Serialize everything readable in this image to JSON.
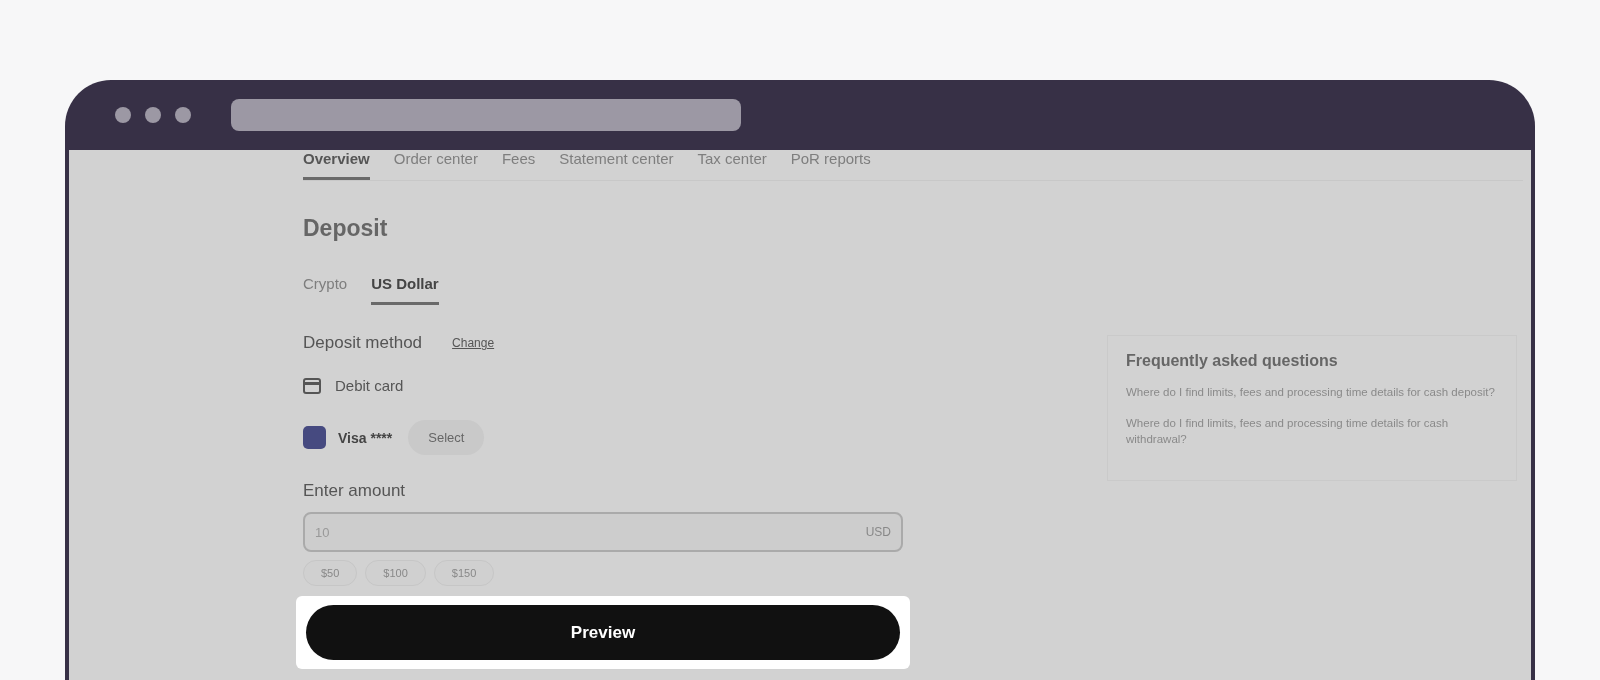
{
  "nav_tabs": [
    {
      "label": "Overview",
      "selected": true
    },
    {
      "label": "Order center",
      "selected": false
    },
    {
      "label": "Fees",
      "selected": false
    },
    {
      "label": "Statement center",
      "selected": false
    },
    {
      "label": "Tax center",
      "selected": false
    },
    {
      "label": "PoR reports",
      "selected": false
    }
  ],
  "title": "Deposit",
  "currency_tabs": [
    {
      "label": "Crypto",
      "selected": false
    },
    {
      "label": "US Dollar",
      "selected": true
    }
  ],
  "deposit_method": {
    "label": "Deposit method",
    "change_link": "Change",
    "method": "Debit card",
    "card_name": "Visa ****",
    "select_button": "Select"
  },
  "amount": {
    "label": "Enter amount",
    "value": "10",
    "currency": "USD",
    "presets": [
      "$50",
      "$100",
      "$150"
    ]
  },
  "preview_button": "Preview",
  "faq": {
    "title": "Frequently asked questions",
    "questions": [
      "Where do I find limits, fees and processing time details for cash deposit?",
      "Where do I find limits, fees and processing time details for cash withdrawal?"
    ]
  }
}
